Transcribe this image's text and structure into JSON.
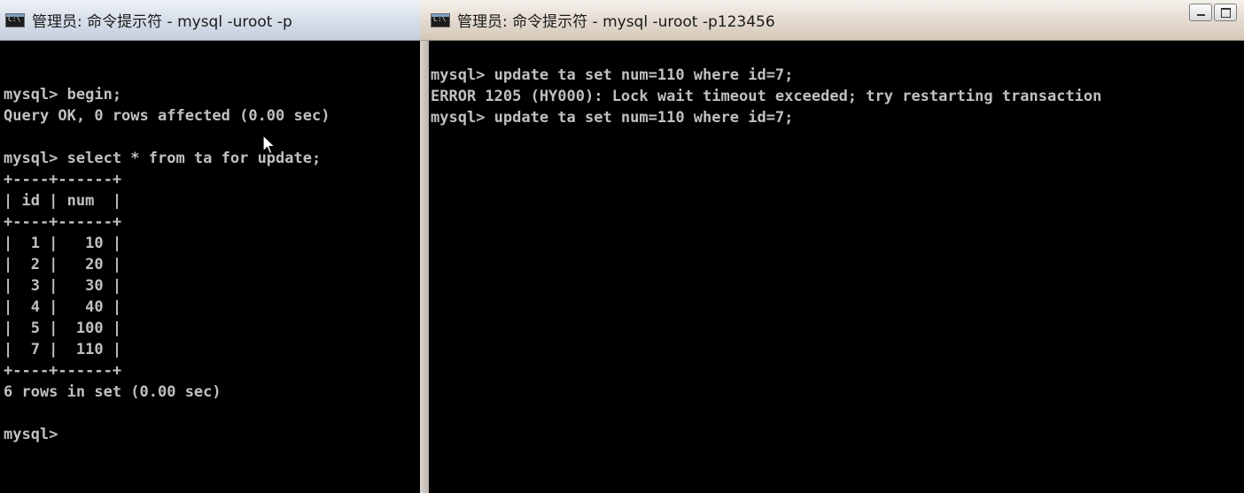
{
  "left_window": {
    "title": "管理员: 命令提示符 - mysql  -uroot -p",
    "lines": [
      "",
      "mysql> begin;",
      "Query OK, 0 rows affected (0.00 sec)",
      "",
      "mysql> select * from ta for update;",
      "+----+------+",
      "| id | num  |",
      "+----+------+",
      "|  1 |   10 |",
      "|  2 |   20 |",
      "|  3 |   30 |",
      "|  4 |   40 |",
      "|  5 |  100 |",
      "|  7 |  110 |",
      "+----+------+",
      "6 rows in set (0.00 sec)",
      "",
      "mysql>"
    ]
  },
  "right_window": {
    "title": "管理员: 命令提示符 - mysql  -uroot -p123456",
    "lines": [
      "mysql> update ta set num=110 where id=7;",
      "ERROR 1205 (HY000): Lock wait timeout exceeded; try restarting transaction",
      "mysql> update ta set num=110 where id=7;"
    ]
  },
  "icons": {
    "console_icon": "cmd-icon",
    "minimize": "minimize-icon",
    "maximize": "maximize-icon",
    "cursor": "mouse-pointer-icon"
  }
}
